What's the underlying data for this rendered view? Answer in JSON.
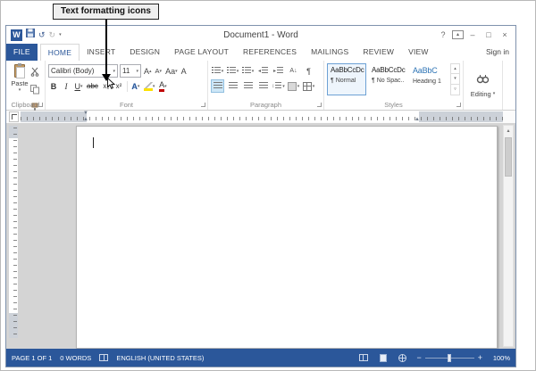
{
  "callout": {
    "label": "Text formatting icons"
  },
  "window": {
    "title": "Document1 - Word",
    "signin": "Sign in"
  },
  "icons": {
    "word_logo": "W",
    "undo": "↺",
    "redo": "↻",
    "dropdown": "▾",
    "up": "▴",
    "more": "▿",
    "help": "?",
    "minimize": "–",
    "maximize": "□",
    "close": "×",
    "pilcrow": "¶",
    "updown": "↕",
    "sort": "A↓",
    "scroll_up": "▴",
    "zoom_out": "−",
    "zoom_in": "+"
  },
  "tabs": {
    "file": "FILE",
    "home": "HOME",
    "insert": "INSERT",
    "design": "DESIGN",
    "page_layout": "PAGE LAYOUT",
    "references": "REFERENCES",
    "mailings": "MAILINGS",
    "review": "REVIEW",
    "view": "VIEW"
  },
  "ribbon": {
    "clipboard": {
      "group_label": "Clipboard",
      "paste_label": "Paste"
    },
    "font": {
      "group_label": "Font",
      "font_name": "Calibri (Body)",
      "font_size": "11",
      "grow_font": "A",
      "shrink_font": "A",
      "change_case": "Aa",
      "clear_formatting": "A",
      "bold": "B",
      "italic": "I",
      "underline": "U",
      "strikethrough": "abc",
      "subscript": "x₂",
      "superscript": "x²",
      "text_effects": "A",
      "font_color": "A"
    },
    "paragraph": {
      "group_label": "Paragraph"
    },
    "styles": {
      "group_label": "Styles",
      "items": [
        {
          "preview": "AaBbCcDc",
          "name": "¶ Normal"
        },
        {
          "preview": "AaBbCcDc",
          "name": "¶ No Spac..."
        },
        {
          "preview": "AaBbC",
          "name": "Heading 1"
        }
      ]
    },
    "editing": {
      "label": "Editing"
    }
  },
  "statusbar": {
    "page": "PAGE 1 OF 1",
    "words": "0 WORDS",
    "language": "ENGLISH (UNITED STATES)",
    "zoom_level": "100%"
  }
}
